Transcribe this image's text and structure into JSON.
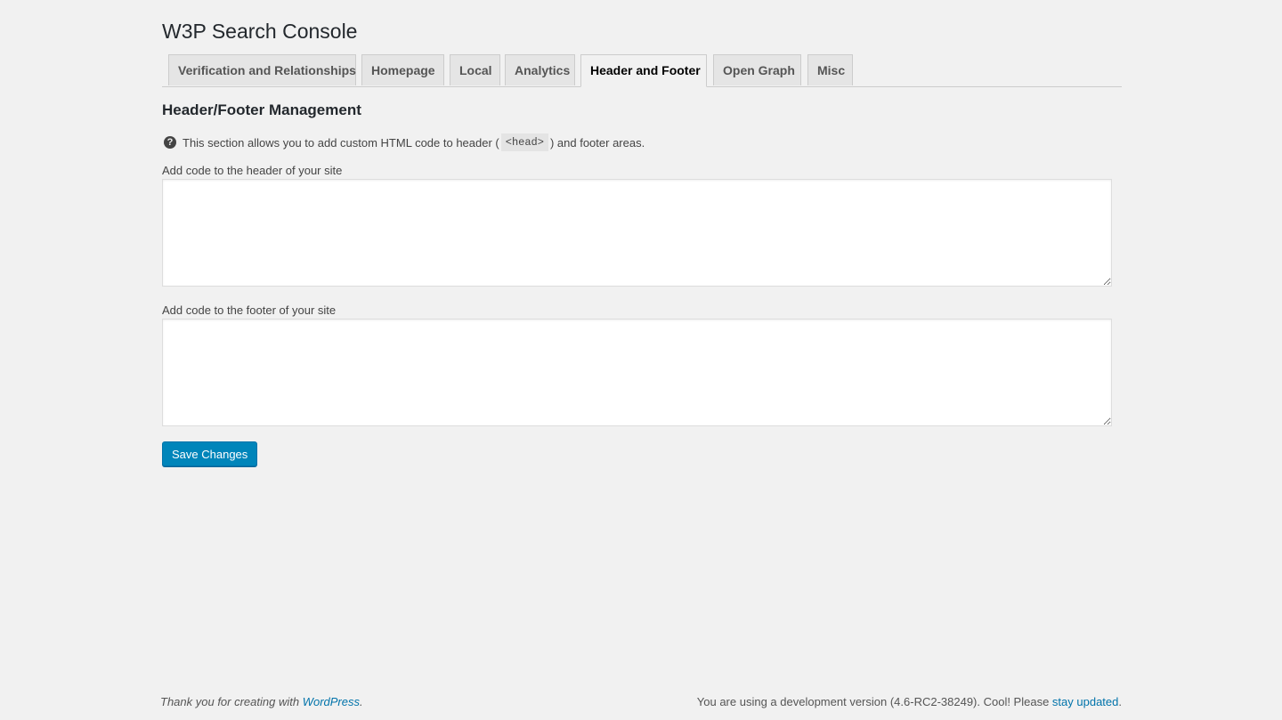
{
  "header": {
    "title": "W3P Search Console"
  },
  "tabs": [
    {
      "label": "Verification and Relationships",
      "active": false
    },
    {
      "label": "Homepage",
      "active": false
    },
    {
      "label": "Local",
      "active": false
    },
    {
      "label": "Analytics",
      "active": false
    },
    {
      "label": "Header and Footer",
      "active": true
    },
    {
      "label": "Open Graph",
      "active": false
    },
    {
      "label": "Misc",
      "active": false
    }
  ],
  "section": {
    "title": "Header/Footer Management",
    "help_icon": "question-circle-icon",
    "help_text_before": "This section allows you to add custom HTML code to header (",
    "help_code": "<head>",
    "help_text_after": ") and footer areas."
  },
  "fields": {
    "header_label": "Add code to the header of your site",
    "header_value": "",
    "footer_label": "Add code to the footer of your site",
    "footer_value": ""
  },
  "actions": {
    "save_label": "Save Changes"
  },
  "footer": {
    "thanks_text": "Thank you for creating with ",
    "thanks_link": "WordPress",
    "thanks_end": ".",
    "version_text": "You are using a development version (4.6-RC2-38249). Cool! Please ",
    "version_link": "stay updated",
    "version_end": "."
  },
  "colors": {
    "accent": "#0085ba",
    "link": "#0073aa",
    "background": "#f1f1f1"
  }
}
